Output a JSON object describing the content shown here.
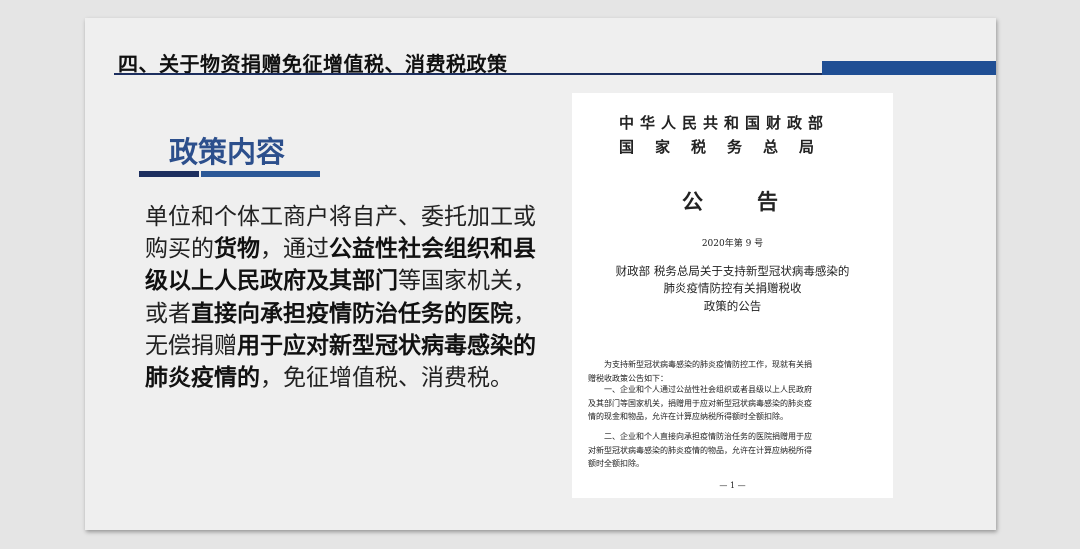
{
  "slide": {
    "title": "四、关于物资捐赠免征增值税、消费税政策",
    "section_heading": "政策内容",
    "body_segments": [
      {
        "text": "单位和个体工商户将自产、委托加工或购买的",
        "bold": false
      },
      {
        "text": "货物",
        "bold": true
      },
      {
        "text": "，通过",
        "bold": false
      },
      {
        "text": "公益性社会组织和县级以上人民政府及其部门",
        "bold": true
      },
      {
        "text": "等国家机关，或者",
        "bold": false
      },
      {
        "text": "直接向承担疫情防治任务的医院",
        "bold": true
      },
      {
        "text": "，无偿捐赠",
        "bold": false
      },
      {
        "text": "用于应对新型冠状病毒感染的肺炎疫情的",
        "bold": true
      },
      {
        "text": "，免征增值税、消费税。",
        "bold": false
      }
    ]
  },
  "document": {
    "org_line1": "中华人民共和国财政部",
    "org_line2": "国家税务总局",
    "notice": "公告",
    "doc_number": "2020年第 9 号",
    "title_lines": [
      "财政部  税务总局关于支持新型冠状病毒感染的",
      "肺炎疫情防控有关捐赠税收",
      "政策的公告"
    ],
    "paragraphs": [
      [
        "为支持新型冠状病毒感染的肺炎疫情防控工作，现就有关捐",
        "赠税收政策公告如下："
      ],
      [
        "一、企业和个人通过公益性社会组织或者县级以上人民政府",
        "及其部门等国家机关，捐赠用于应对新型冠状病毒感染的肺炎疫",
        "情的现金和物品，允许在计算应纳税所得额时全额扣除。"
      ],
      [
        "二、企业和个人直接向承担疫情防治任务的医院捐赠用于应",
        "对新型冠状病毒感染的肺炎疫情的物品，允许在计算应纳税所得",
        "额时全额扣除。"
      ]
    ],
    "page_number": "— 1 —"
  },
  "colors": {
    "accent_dark": "#1d2f5f",
    "accent_blue": "#1f4e94",
    "heading_blue": "#2c4f8c"
  }
}
